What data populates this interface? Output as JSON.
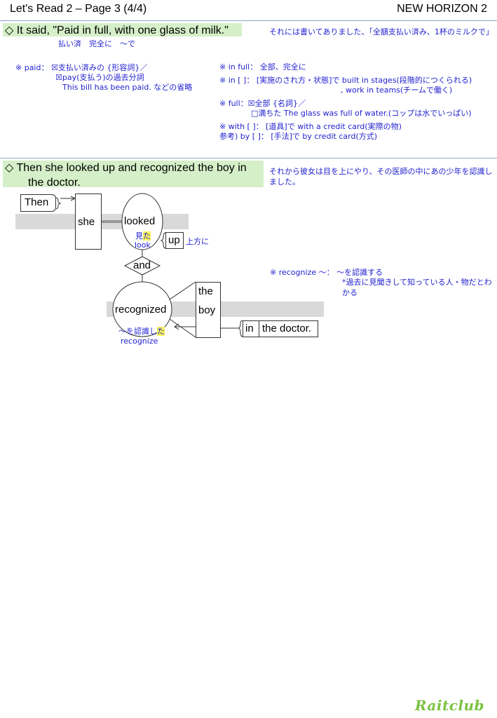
{
  "header": {
    "title": "Let's Read 2 – Page 3 (4/4)",
    "textbook": "NEW HORIZON 2"
  },
  "section1": {
    "sentence": "◇ It said, \"Paid in full, with one glass of milk.\"",
    "gloss": "払い済　完全に　～で",
    "translation": "それには書いてありました、「全額支払い済み、1杯のミルクで」",
    "notes_left": [
      "※ paid： ☒支払い済みの {形容詞}／",
      "☒pay(支払う)の過去分詞",
      "This bill has been paid. などの省略"
    ],
    "notes_right": [
      "※ in full： 全部、完全に",
      "※ in [ ]： [実施のされ方・状態]で built in stages(段階的につくられる)",
      ", work in teams(チームで働く)",
      "※ full：☒全部 {名詞}／",
      "□満ちた The glass was full of water.(コップは水でいっぱい)",
      "※ with [ ]： [道具]で  with a credit card(実際の物)",
      "参考) by [ ]： [手法]で by credit card(方式)"
    ]
  },
  "section2": {
    "sentence_line1": "◇ Then she looked up and recognized the boy in",
    "sentence_line2": "the doctor.",
    "translation": "それから彼女は目を上にやり、その医師の中にあの少年を認識しました。",
    "diagram": {
      "then": "Then",
      "she": "she",
      "looked": "looked",
      "looked_gloss_kanji": "見",
      "looked_gloss_suffix": "た",
      "looked_base": "look",
      "up": "up",
      "up_gloss": "上方に",
      "and": "and",
      "recognized": "recognized",
      "recognized_gloss_prefix": "～を認識し",
      "recognized_gloss_suffix": "た",
      "recognized_base": "recognize",
      "the": "the",
      "boy": "boy",
      "in": "in",
      "the_doctor": "the doctor."
    },
    "notes": [
      "※ recognize ～： ～を認識する",
      "*過去に見聞きして知っている人・物だとわかる"
    ]
  },
  "footer": {
    "logo": "Raitclub"
  }
}
